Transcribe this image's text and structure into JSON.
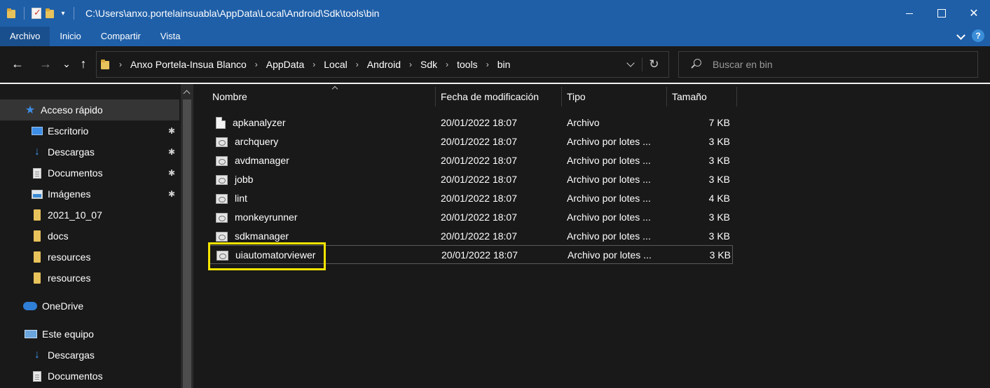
{
  "title_bar": {
    "path": "C:\\Users\\anxo.portelainsuabla\\AppData\\Local\\Android\\Sdk\\tools\\bin",
    "controls": [
      "minimize",
      "maximize",
      "close"
    ],
    "close_glyph": "✕"
  },
  "ribbon": {
    "tabs": [
      {
        "label": "Archivo",
        "active": true
      },
      {
        "label": "Inicio",
        "active": false
      },
      {
        "label": "Compartir",
        "active": false
      },
      {
        "label": "Vista",
        "active": false
      }
    ],
    "help_glyph": "?"
  },
  "nav": {
    "back_glyph": "←",
    "forward_glyph": "→",
    "recent_glyph": "⌄",
    "up_glyph": "↑",
    "refresh_glyph": "↻",
    "breadcrumbs": [
      "Anxo Portela-Insua Blanco",
      "AppData",
      "Local",
      "Android",
      "Sdk",
      "tools",
      "bin"
    ],
    "crumb_separator": "›",
    "search_placeholder": "Buscar en bin"
  },
  "sidebar": {
    "items": [
      {
        "label": "Acceso rápido",
        "icon": "star-icon",
        "pinned": false,
        "selected": true
      },
      {
        "label": "Escritorio",
        "icon": "desktop-icon",
        "pinned": true,
        "selected": false
      },
      {
        "label": "Descargas",
        "icon": "download-icon",
        "pinned": true,
        "selected": false
      },
      {
        "label": "Documentos",
        "icon": "document-icon",
        "pinned": true,
        "selected": false
      },
      {
        "label": "Imágenes",
        "icon": "pictures-icon",
        "pinned": true,
        "selected": false
      },
      {
        "label": "2021_10_07",
        "icon": "folder-icon",
        "pinned": false,
        "selected": false
      },
      {
        "label": "docs",
        "icon": "folder-icon",
        "pinned": false,
        "selected": false
      },
      {
        "label": "resources",
        "icon": "folder-icon",
        "pinned": false,
        "selected": false
      },
      {
        "label": "resources",
        "icon": "folder-icon",
        "pinned": false,
        "selected": false
      },
      {
        "label": "OneDrive",
        "icon": "onedrive-icon",
        "pinned": false,
        "selected": false
      },
      {
        "label": "Este equipo",
        "icon": "this-pc-icon",
        "pinned": false,
        "selected": false
      },
      {
        "label": "Descargas",
        "icon": "download-icon",
        "pinned": false,
        "selected": false
      },
      {
        "label": "Documentos",
        "icon": "document-icon",
        "pinned": false,
        "selected": false
      }
    ],
    "pin_glyph": "📌"
  },
  "file_list": {
    "columns": [
      "Nombre",
      "Fecha de modificación",
      "Tipo",
      "Tamaño"
    ],
    "sorted_by": "Nombre",
    "rows": [
      {
        "name": "apkanalyzer",
        "date": "20/01/2022 18:07",
        "type": "Archivo",
        "size": "7 KB",
        "icon": "file-icon"
      },
      {
        "name": "archquery",
        "date": "20/01/2022 18:07",
        "type": "Archivo por lotes ...",
        "size": "3 KB",
        "icon": "batch-file-icon"
      },
      {
        "name": "avdmanager",
        "date": "20/01/2022 18:07",
        "type": "Archivo por lotes ...",
        "size": "3 KB",
        "icon": "batch-file-icon"
      },
      {
        "name": "jobb",
        "date": "20/01/2022 18:07",
        "type": "Archivo por lotes ...",
        "size": "3 KB",
        "icon": "batch-file-icon"
      },
      {
        "name": "lint",
        "date": "20/01/2022 18:07",
        "type": "Archivo por lotes ...",
        "size": "4 KB",
        "icon": "batch-file-icon"
      },
      {
        "name": "monkeyrunner",
        "date": "20/01/2022 18:07",
        "type": "Archivo por lotes ...",
        "size": "3 KB",
        "icon": "batch-file-icon"
      },
      {
        "name": "sdkmanager",
        "date": "20/01/2022 18:07",
        "type": "Archivo por lotes ...",
        "size": "3 KB",
        "icon": "batch-file-icon"
      },
      {
        "name": "uiautomatorviewer",
        "date": "20/01/2022 18:07",
        "type": "Archivo por lotes ...",
        "size": "3 KB",
        "icon": "batch-file-icon",
        "highlighted": true
      }
    ]
  },
  "colors": {
    "title_bar": "#1f5fa8",
    "background": "#191919",
    "accent": "#3d8ee6",
    "highlight": "#f5e400"
  }
}
